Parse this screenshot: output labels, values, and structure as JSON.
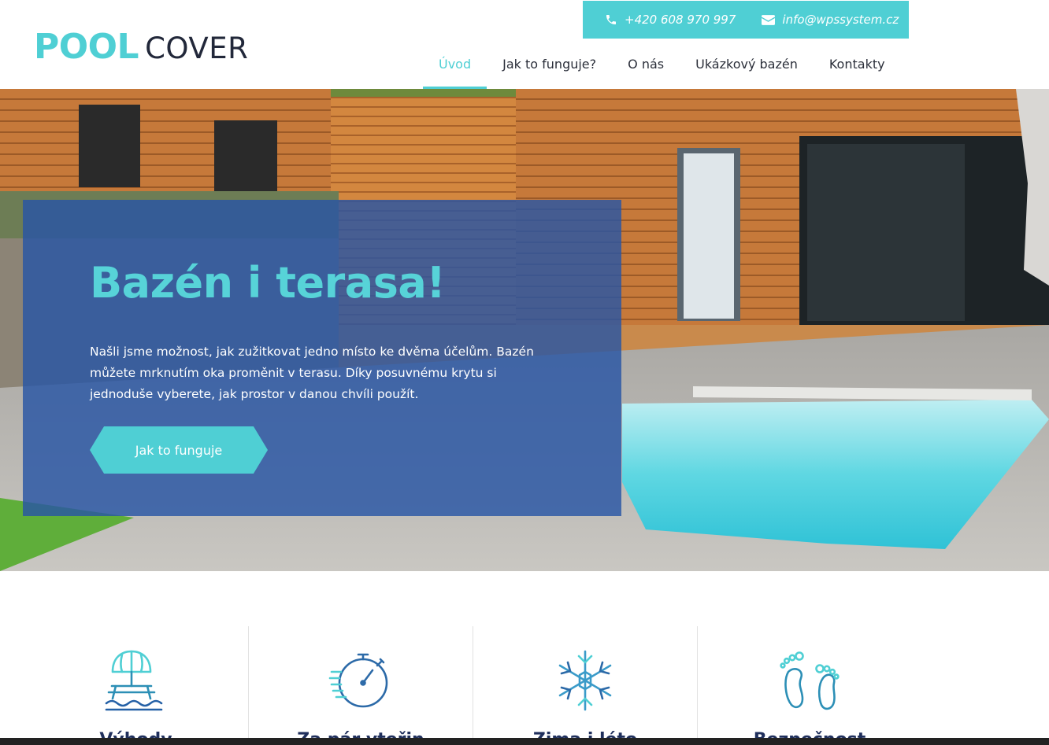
{
  "header": {
    "logo": {
      "word1": "POOL",
      "word2": "COVER"
    },
    "contact": {
      "phone": "+420 608 970 997",
      "phone_icon": "phone-icon",
      "email": "info@wpssystem.cz",
      "email_icon": "envelope-icon"
    },
    "nav": [
      {
        "label": "Úvod",
        "active": true
      },
      {
        "label": "Jak to funguje?",
        "active": false
      },
      {
        "label": "O nás",
        "active": false
      },
      {
        "label": "Ukázkový bazén",
        "active": false
      },
      {
        "label": "Kontakty",
        "active": false
      }
    ]
  },
  "hero": {
    "title": "Bazén i terasa!",
    "text": "Našli jsme možnost, jak zužitkovat jedno místo ke dvěma účelům. Bazén můžete mrknutím oka proměnit v terasu. Díky posuvnému krytu si jednoduše vyberete, jak prostor v danou chvíli použít.",
    "button": "Jak to funguje",
    "background": "photo of a wooden house terrace with a swimming pool"
  },
  "features": [
    {
      "icon": "beach-umbrella-picnic-icon",
      "title": "Výhody"
    },
    {
      "icon": "stopwatch-icon",
      "title": "Za pár vteřin"
    },
    {
      "icon": "snowflake-icon",
      "title": "Zima i léto"
    },
    {
      "icon": "footprints-icon",
      "title": "Bezpečnost"
    }
  ],
  "colors": {
    "accent": "#4fcfd4",
    "panel": "#2855a5",
    "dark_text": "#1f2f5c"
  }
}
